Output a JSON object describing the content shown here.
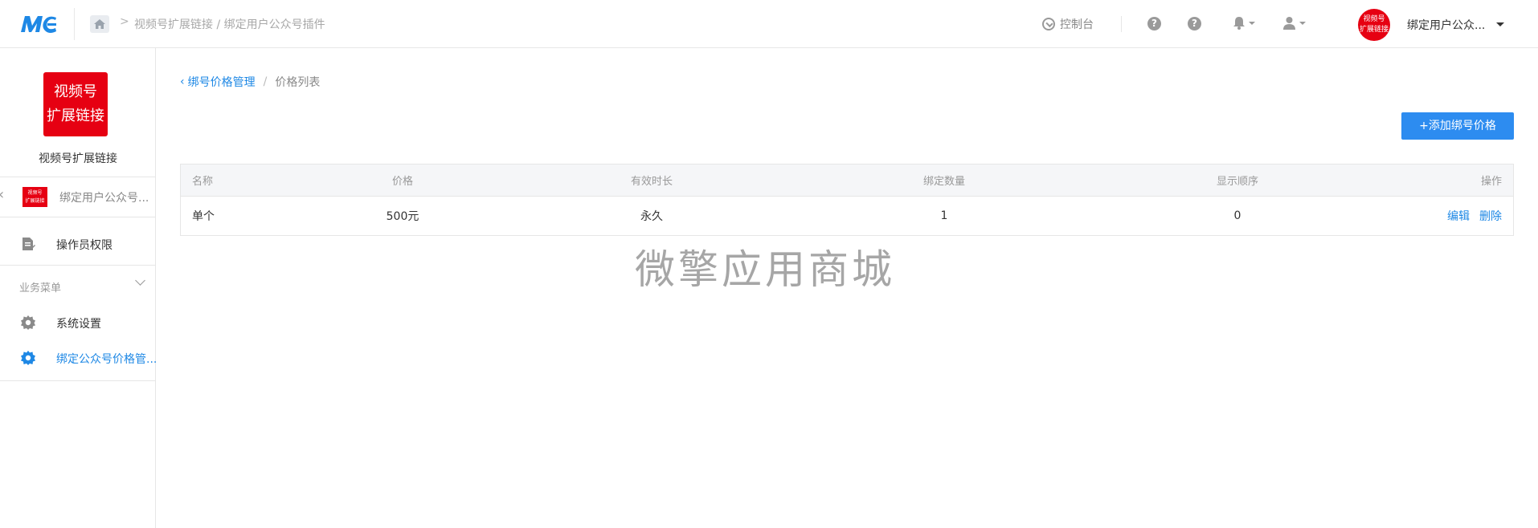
{
  "topbar": {
    "logo_text": "MC",
    "breadcrumb": "视频号扩展链接 / 绑定用户公众号插件",
    "console_label": "控制台",
    "account_name": "绑定用户公众...",
    "avatar_text_line1": "视频号",
    "avatar_text_line2": "扩展链接"
  },
  "sidebar": {
    "app_logo_line1": "视频号",
    "app_logo_line2": "扩展链接",
    "app_name": "视频号扩展链接",
    "plugin_thumb_line1": "视频号",
    "plugin_thumb_line2": "扩展链接",
    "plugin_name": "绑定用户公众号...",
    "operator_label": "操作员权限",
    "section_label": "业务菜单",
    "items": [
      {
        "label": "系统设置"
      },
      {
        "label": "绑定公众号价格管..."
      }
    ]
  },
  "main": {
    "breadcrumb": {
      "parent": "绑号价格管理",
      "separator": "/",
      "current": "价格列表"
    },
    "add_button": "+添加绑号价格",
    "table": {
      "headers": [
        "名称",
        "价格",
        "有效时长",
        "绑定数量",
        "显示顺序",
        "操作"
      ],
      "rows": [
        {
          "name": "单个",
          "price": "500元",
          "duration": "永久",
          "count": "1",
          "order": "0",
          "edit": "编辑",
          "delete": "删除"
        }
      ]
    },
    "watermark": "微擎应用商城"
  },
  "colors": {
    "accent": "#1e88e5",
    "button": "#2d8cf0",
    "brand_red": "#e60012"
  }
}
